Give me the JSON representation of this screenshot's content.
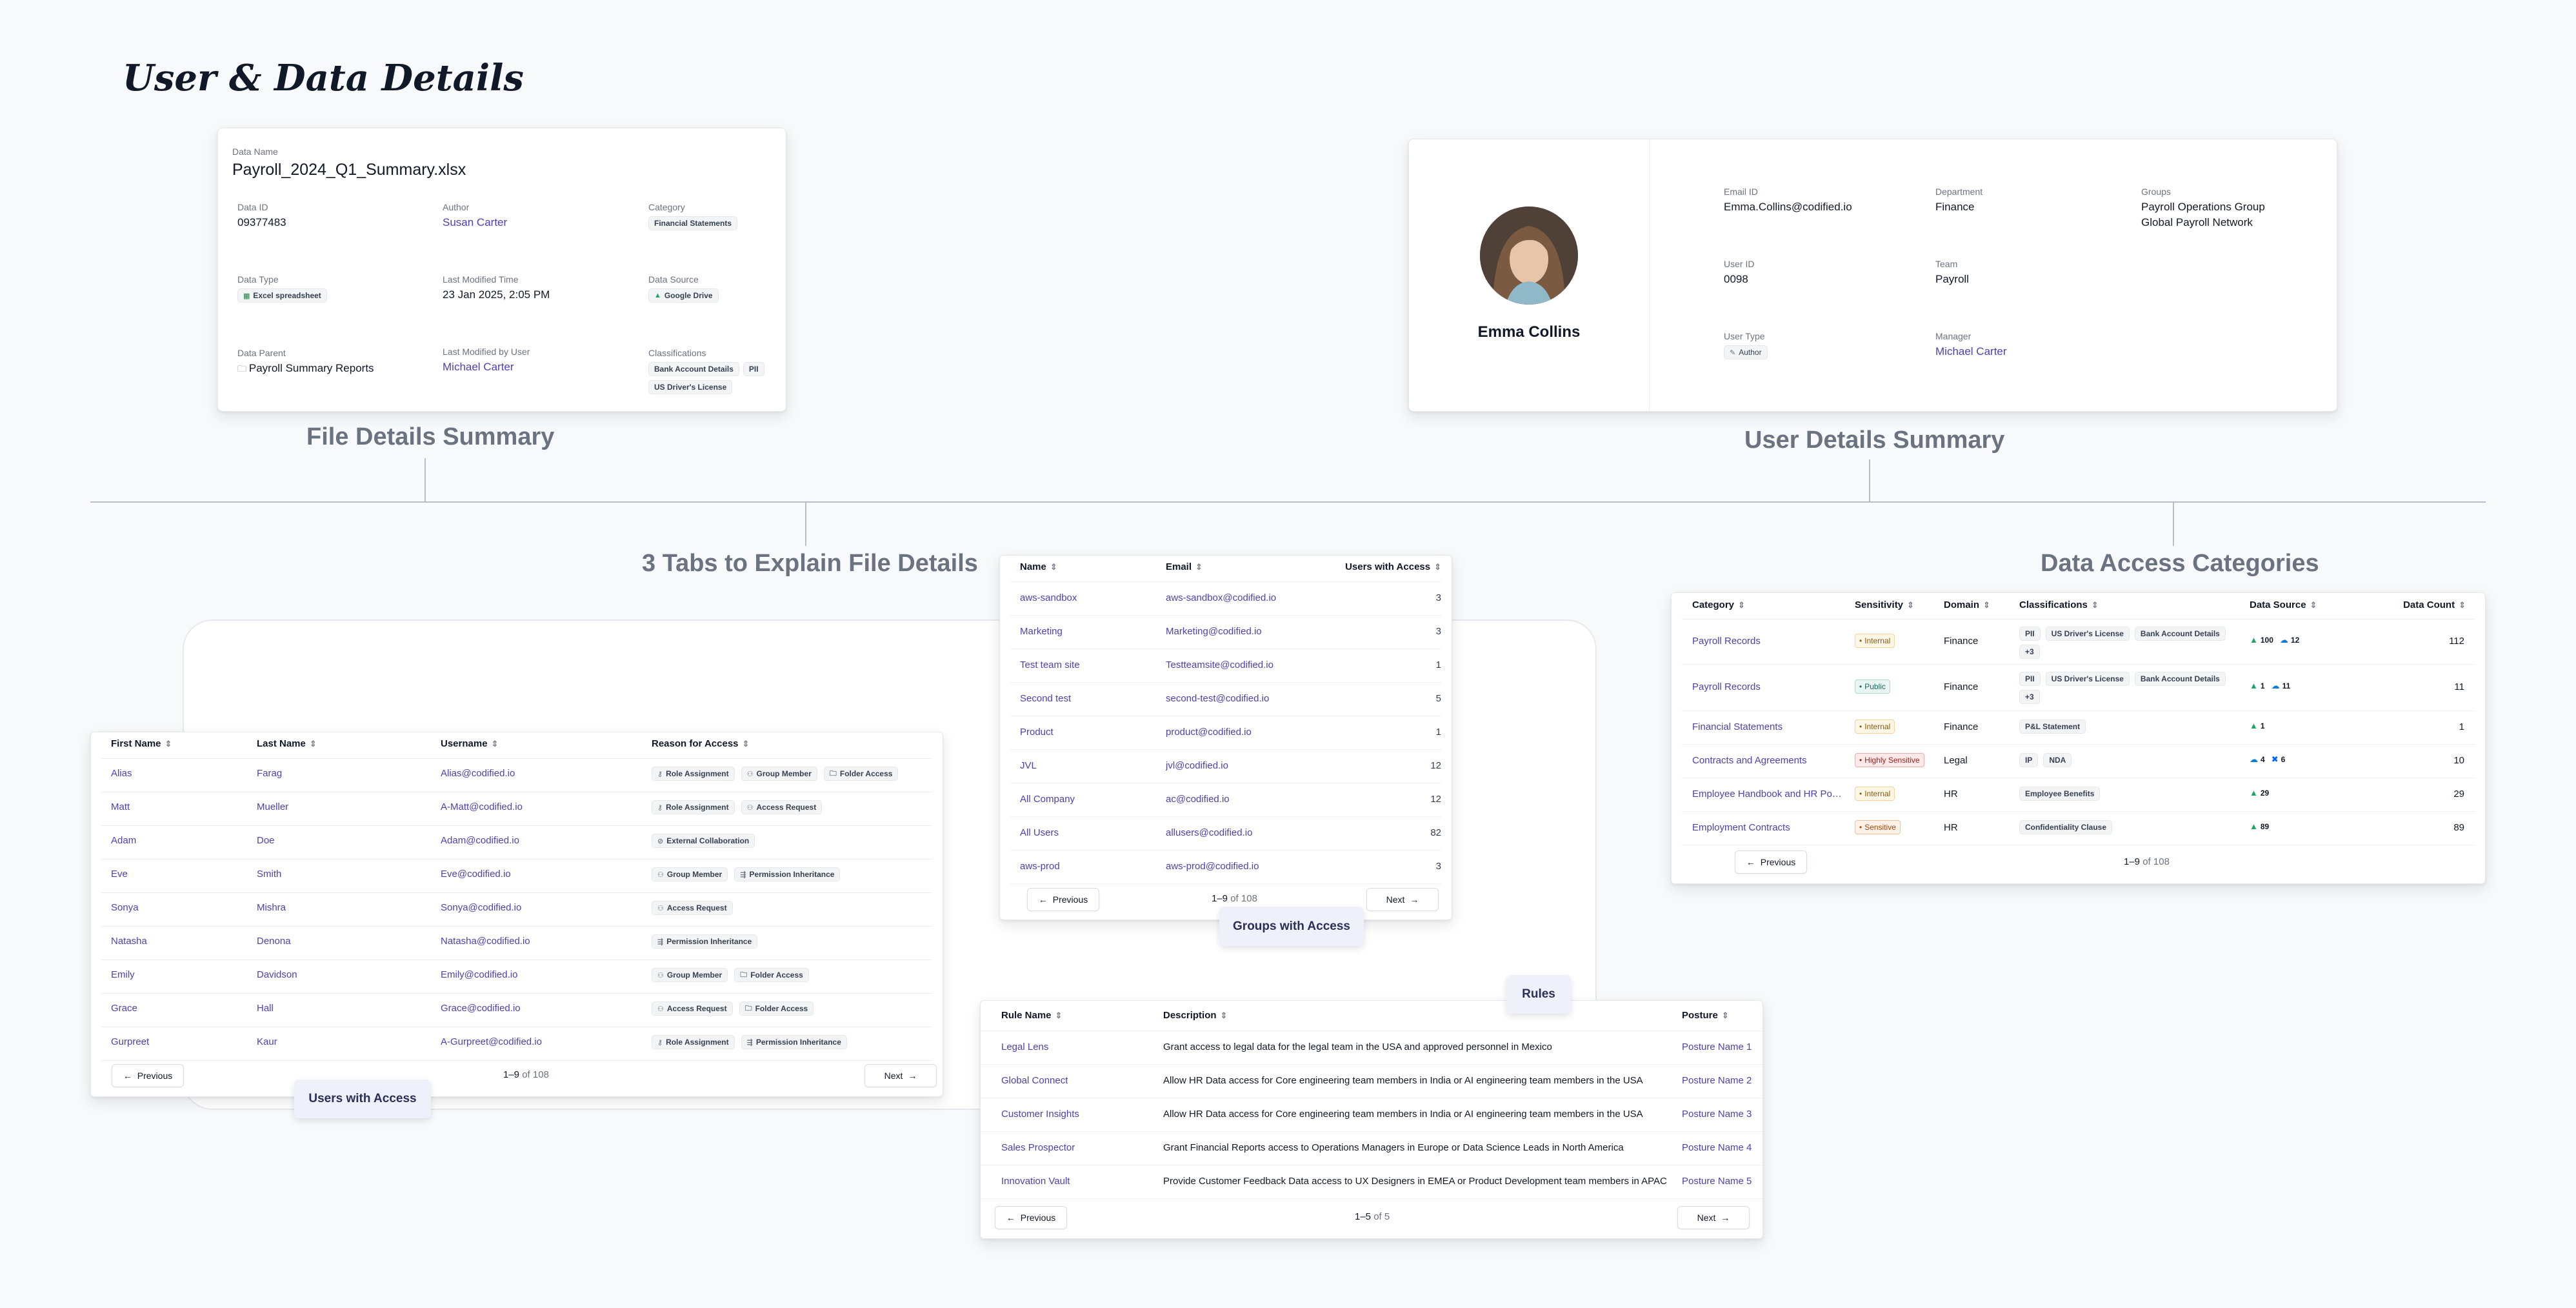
{
  "page_title": "User & Data Details",
  "sections": {
    "file_details": "File Details Summary",
    "user_details": "User Details Summary",
    "tabs": "3 Tabs to Explain File Details",
    "access_categories": "Data Access Categories"
  },
  "file": {
    "data_name_label": "Data Name",
    "data_name": "Payroll_2024_Q1_Summary.xlsx",
    "data_id_label": "Data ID",
    "data_id": "09377483",
    "author_label": "Author",
    "author": "Susan Carter",
    "category_label": "Category",
    "category": "Financial Statements",
    "data_type_label": "Data Type",
    "data_type": "Excel spreadsheet",
    "modified_time_label": "Last Modified Time",
    "modified_time": "23 Jan 2025, 2:05 PM",
    "source_label": "Data Source",
    "source": "Google Drive",
    "parent_label": "Data Parent",
    "parent": "Payroll Summary Reports",
    "modified_by_label": "Last Modified by User",
    "modified_by": "Michael Carter",
    "classifications_label": "Classifications",
    "classifications": [
      "Bank Account Details",
      "PII",
      "US Driver's License"
    ]
  },
  "user": {
    "name": "Emma Collins",
    "email_label": "Email ID",
    "email": "Emma.Collins@codified.io",
    "department_label": "Department",
    "department": "Finance",
    "groups_label": "Groups",
    "groups": [
      "Payroll Operations Group",
      "Global Payroll Network"
    ],
    "user_id_label": "User ID",
    "user_id": "0098",
    "team_label": "Team",
    "team": "Payroll",
    "user_type_label": "User Type",
    "user_type": "Author",
    "manager_label": "Manager",
    "manager": "Michael Carter"
  },
  "users_table": {
    "headers": [
      "First Name",
      "Last Name",
      "Username",
      "Reason for Access"
    ],
    "rows": [
      {
        "first": "Alias",
        "last": "Farag",
        "username": "Alias@codified.io",
        "reasons": [
          "Role Assignment",
          "Group Member",
          "Folder Access"
        ]
      },
      {
        "first": "Matt",
        "last": "Mueller",
        "username": "A-Matt@codified.io",
        "reasons": [
          "Role Assignment",
          "Access Request"
        ]
      },
      {
        "first": "Adam",
        "last": "Doe",
        "username": "Adam@codified.io",
        "reasons": [
          "External Collaboration"
        ]
      },
      {
        "first": "Eve",
        "last": "Smith",
        "username": "Eve@codified.io",
        "reasons": [
          "Group Member",
          "Permission Inheritance"
        ]
      },
      {
        "first": "Sonya",
        "last": "Mishra",
        "username": "Sonya@codified.io",
        "reasons": [
          "Access Request"
        ]
      },
      {
        "first": "Natasha",
        "last": "Denona",
        "username": "Natasha@codified.io",
        "reasons": [
          "Permission Inheritance"
        ]
      },
      {
        "first": "Emily",
        "last": "Davidson",
        "username": "Emily@codified.io",
        "reasons": [
          "Group Member",
          "Folder Access"
        ]
      },
      {
        "first": "Grace",
        "last": "Hall",
        "username": "Grace@codified.io",
        "reasons": [
          "Access Request",
          "Folder Access"
        ]
      },
      {
        "first": "Gurpreet",
        "last": "Kaur",
        "username": "A-Gurpreet@codified.io",
        "reasons": [
          "Role Assignment",
          "Permission Inheritance"
        ]
      }
    ],
    "pager_range": "1–9",
    "pager_total": "of 108",
    "prev": "Previous",
    "next": "Next",
    "tag": "Users with Access"
  },
  "groups_table": {
    "headers": [
      "Name",
      "Email",
      "Users with Access"
    ],
    "rows": [
      {
        "name": "aws-sandbox",
        "email": "aws-sandbox@codified.io",
        "count": "3"
      },
      {
        "name": "Marketing",
        "email": "Marketing@codified.io",
        "count": "3"
      },
      {
        "name": "Test team site",
        "email": "Testteamsite@codified.io",
        "count": "1"
      },
      {
        "name": "Second test",
        "email": "second-test@codified.io",
        "count": "5"
      },
      {
        "name": "Product",
        "email": "product@codified.io",
        "count": "1"
      },
      {
        "name": "JVL",
        "email": "jvl@codified.io",
        "count": "12"
      },
      {
        "name": "All Company",
        "email": "ac@codified.io",
        "count": "12"
      },
      {
        "name": "All Users",
        "email": "allusers@codified.io",
        "count": "82"
      },
      {
        "name": "aws-prod",
        "email": "aws-prod@codified.io",
        "count": "3"
      }
    ],
    "pager_range": "1–9",
    "pager_total": "of 108",
    "prev": "Previous",
    "next": "Next",
    "tag": "Groups with Access"
  },
  "rules_table": {
    "headers": [
      "Rule Name",
      "Description",
      "Posture"
    ],
    "rows": [
      {
        "name": "Legal Lens",
        "desc": "Grant access to legal data for the legal team in the USA and approved personnel in Mexico",
        "posture": "Posture Name 1"
      },
      {
        "name": "Global Connect",
        "desc": "Allow HR Data access for Core engineering team members in India or AI engineering team members in the USA",
        "posture": "Posture Name 2"
      },
      {
        "name": "Customer Insights",
        "desc": "Allow HR Data access for Core engineering team members in India or AI engineering team members in the USA",
        "posture": "Posture Name 3"
      },
      {
        "name": "Sales Prospector",
        "desc": "Grant Financial Reports access to Operations Managers in Europe or Data Science Leads in North America",
        "posture": "Posture Name 4"
      },
      {
        "name": "Innovation Vault",
        "desc": "Provide Customer Feedback Data access to UX Designers in EMEA or Product Development team members in APAC",
        "posture": "Posture Name 5"
      }
    ],
    "pager_range": "1–5",
    "pager_total": "of 5",
    "prev": "Previous",
    "next": "Next",
    "tag": "Rules"
  },
  "categories_table": {
    "headers": [
      "Category",
      "Sensitivity",
      "Domain",
      "Classifications",
      "Data Source",
      "Data Count"
    ],
    "rows": [
      {
        "category": "Payroll Records",
        "sensitivity": "Internal",
        "sens_class": "b-int",
        "domain": "Finance",
        "classes": [
          "PII",
          "US Driver's License",
          "Bank Account Details",
          "+3"
        ],
        "sources": [
          {
            "icon": "drive",
            "n": "100"
          },
          {
            "icon": "cloud",
            "n": "12"
          }
        ],
        "count": "112"
      },
      {
        "category": "Payroll Records",
        "sensitivity": "Public",
        "sens_class": "b-pub",
        "domain": "Finance",
        "classes": [
          "PII",
          "US Driver's License",
          "Bank Account Details",
          "+3"
        ],
        "sources": [
          {
            "icon": "drive",
            "n": "1"
          },
          {
            "icon": "cloud",
            "n": "11"
          }
        ],
        "count": "11"
      },
      {
        "category": "Financial Statements",
        "sensitivity": "Internal",
        "sens_class": "b-int",
        "domain": "Finance",
        "classes": [
          "P&L Statement"
        ],
        "sources": [
          {
            "icon": "drive",
            "n": "1"
          }
        ],
        "count": "1"
      },
      {
        "category": "Contracts and Agreements",
        "sensitivity": "Highly Sensitive",
        "sens_class": "b-hs",
        "domain": "Legal",
        "classes": [
          "IP",
          "NDA"
        ],
        "sources": [
          {
            "icon": "cloud",
            "n": "4"
          },
          {
            "icon": "dropbox",
            "n": "6"
          }
        ],
        "count": "10"
      },
      {
        "category": "Employee Handbook and HR Polic...",
        "sensitivity": "Internal",
        "sens_class": "b-int",
        "domain": "HR",
        "classes": [
          "Employee Benefits"
        ],
        "sources": [
          {
            "icon": "drive",
            "n": "29"
          }
        ],
        "count": "29"
      },
      {
        "category": "Employment Contracts",
        "sensitivity": "Sensitive",
        "sens_class": "b-sen",
        "domain": "HR",
        "classes": [
          "Confidentiality Clause"
        ],
        "sources": [
          {
            "icon": "drive",
            "n": "89"
          }
        ],
        "count": "89"
      }
    ],
    "pager_range": "1–9",
    "pager_total": "of 108",
    "prev": "Previous"
  },
  "colors": {
    "accent_link": "#4f3fb3",
    "background": "#f8f9fb",
    "connector": "#b8bec8"
  }
}
